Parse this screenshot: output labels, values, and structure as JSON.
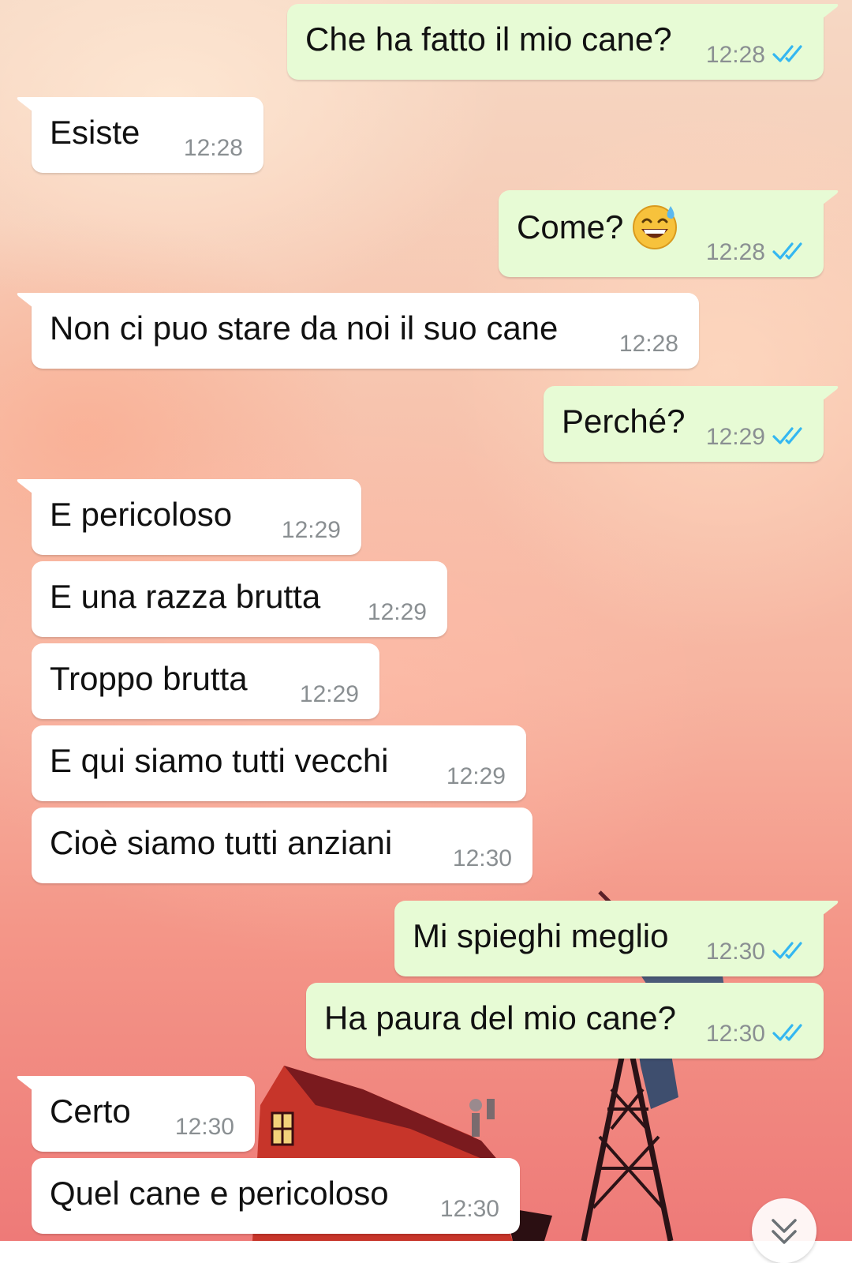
{
  "messages": [
    {
      "dir": "out",
      "text": "Che ha fatto il mio cane?",
      "time": "12:28",
      "read": true
    },
    {
      "dir": "in",
      "text": "Esiste",
      "time": "12:28"
    },
    {
      "dir": "out",
      "text": "Come?",
      "time": "12:28",
      "read": true,
      "emoji": "grinning-face-with-sweat"
    },
    {
      "dir": "in",
      "text": "Non ci puo stare da noi il suo cane",
      "time": "12:28"
    },
    {
      "dir": "out",
      "text": "Perché?",
      "time": "12:29",
      "read": true
    },
    {
      "dir": "in",
      "text": "E pericoloso",
      "time": "12:29"
    },
    {
      "dir": "in",
      "text": "E una razza brutta",
      "time": "12:29"
    },
    {
      "dir": "in",
      "text": "Troppo brutta",
      "time": "12:29"
    },
    {
      "dir": "in",
      "text": "E qui siamo tutti vecchi",
      "time": "12:29"
    },
    {
      "dir": "in",
      "text": "Cioè siamo tutti anziani",
      "time": "12:30"
    },
    {
      "dir": "out",
      "text": "Mi spieghi meglio",
      "time": "12:30",
      "read": true
    },
    {
      "dir": "out",
      "text": "Ha paura del mio cane?",
      "time": "12:30",
      "read": true
    },
    {
      "dir": "in",
      "text": "Certo",
      "time": "12:30"
    },
    {
      "dir": "in",
      "text": "Quel cane e pericoloso",
      "time": "12:30"
    }
  ],
  "colors": {
    "incoming_bubble": "#ffffff",
    "outgoing_bubble": "#e7fbd5",
    "read_ticks": "#34b7f1",
    "timestamp": "#8a8f92"
  },
  "icons": {
    "read_receipt": "double-check-icon",
    "scroll_down": "double-chevron-down-icon",
    "emoji": "grinning-face-with-sweat-emoji"
  }
}
